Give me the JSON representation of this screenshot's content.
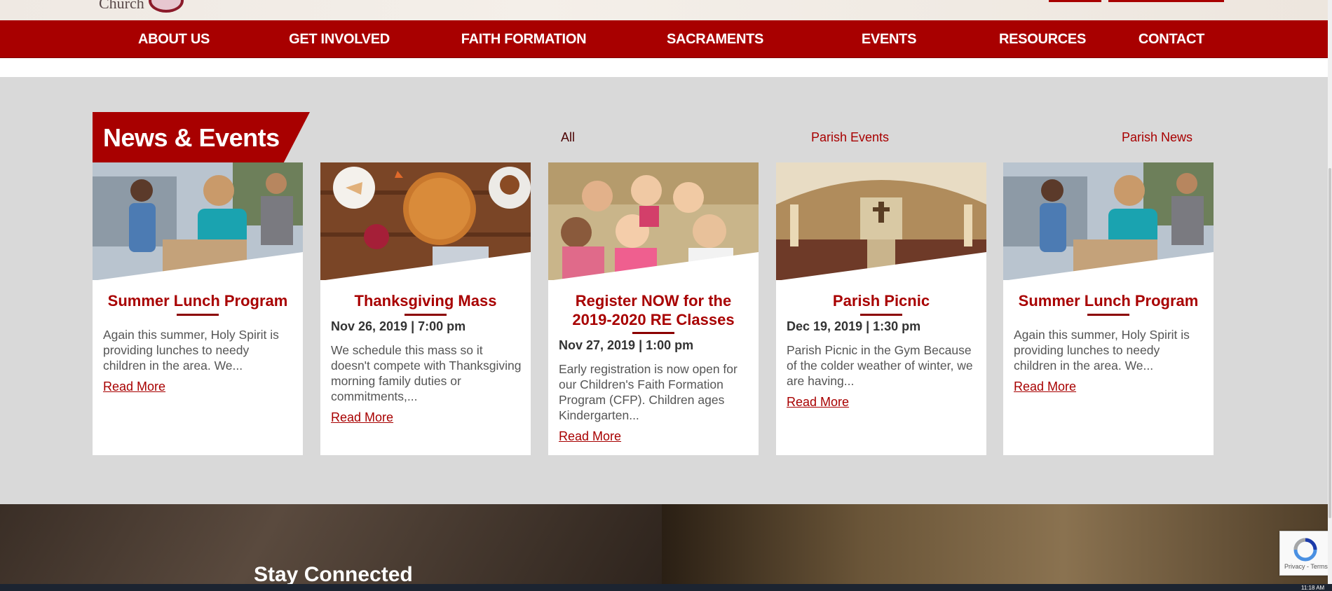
{
  "header": {
    "logo_text": "Church"
  },
  "nav": {
    "items": [
      {
        "label": "ABOUT US"
      },
      {
        "label": "GET INVOLVED"
      },
      {
        "label": "FAITH FORMATION"
      },
      {
        "label": "SACRAMENTS"
      },
      {
        "label": "EVENTS"
      },
      {
        "label": "RESOURCES"
      },
      {
        "label": "CONTACT"
      }
    ]
  },
  "news": {
    "heading": "News & Events",
    "filters": [
      {
        "label": "All"
      },
      {
        "label": "Parish Events"
      },
      {
        "label": "Parish News"
      }
    ],
    "cards": [
      {
        "title": "Summer Lunch Program",
        "meta": "",
        "excerpt": "Again this summer, Holy Spirit is providing lunches to needy children in the area. We...",
        "read_more": "Read More",
        "image": "volunteers-photo"
      },
      {
        "title": "Thanksgiving Mass",
        "meta": "Nov 26, 2019 | 7:00 pm",
        "excerpt": "We schedule this mass so it doesn't compete with Thanksgiving morning family duties or commitments,...",
        "read_more": "Read More",
        "image": "pie-table-photo"
      },
      {
        "title": "Register NOW for the 2019-2020 RE Classes",
        "meta": "Nov 27, 2019 | 1:00 pm",
        "excerpt": "Early registration is now open for our Children's Faith Formation Program (CFP). Children ages Kindergarten...",
        "read_more": "Read More",
        "image": "children-photo"
      },
      {
        "title": "Parish Picnic",
        "meta": "Dec 19, 2019 | 1:30 pm",
        "excerpt": "Parish Picnic in the Gym Because of the colder weather of winter, we are having...",
        "read_more": "Read More",
        "image": "church-interior-photo"
      },
      {
        "title": "Summer Lunch Program",
        "meta": "",
        "excerpt": "Again this summer, Holy Spirit is providing lunches to needy children in the area. We...",
        "read_more": "Read More",
        "image": "volunteers-photo"
      }
    ]
  },
  "bottom": {
    "stay_connected": "Stay Connected"
  },
  "recaptcha": {
    "text": "Privacy - Terms"
  },
  "taskbar": {
    "clock": "11:18 AM"
  },
  "colors": {
    "brand_red": "#a80000",
    "section_bg": "#d9d9d9"
  }
}
